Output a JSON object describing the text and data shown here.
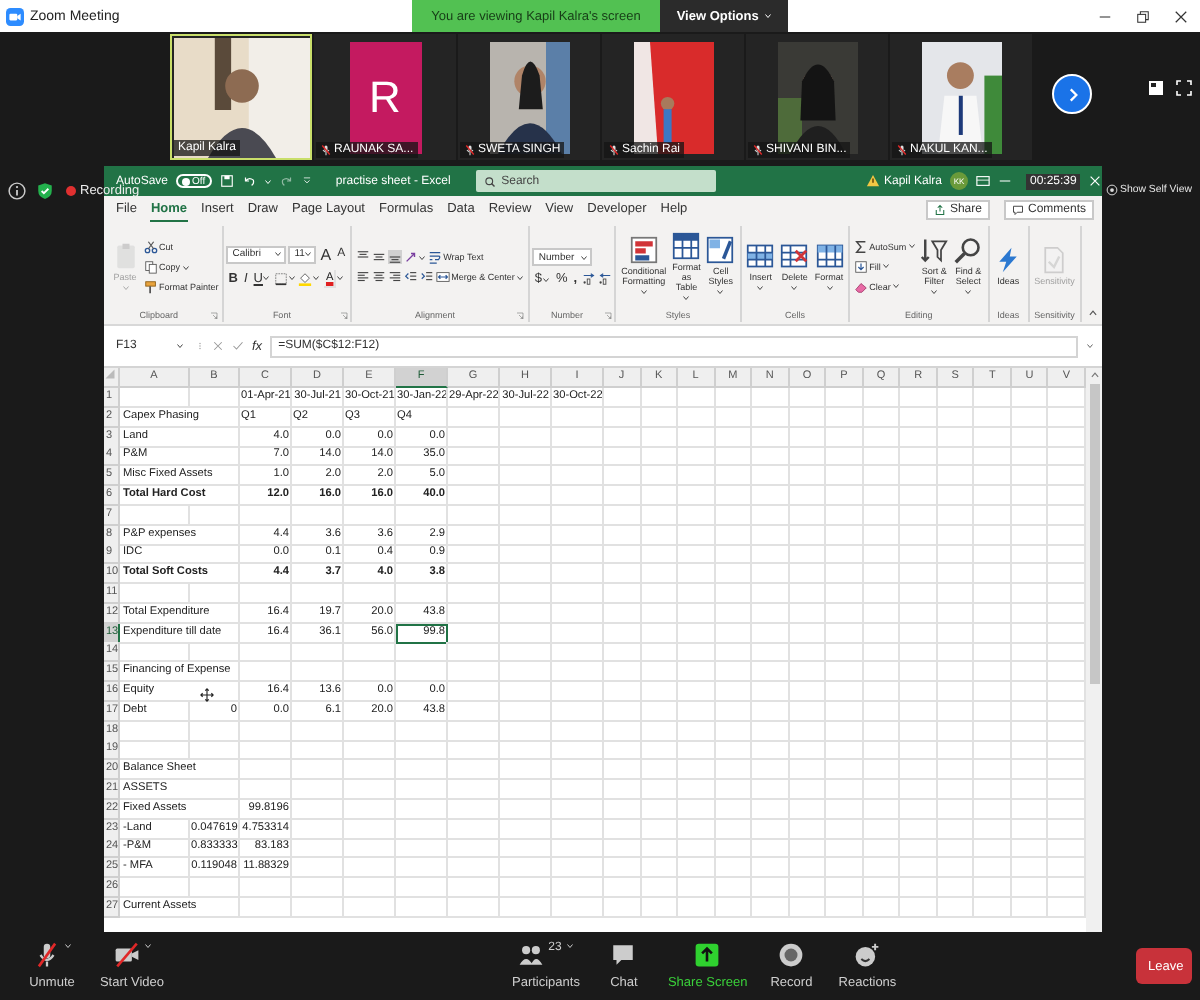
{
  "meeting": {
    "title": "Zoom Meeting",
    "banner": "You are viewing Kapil Kalra's screen",
    "view_options": "View Options",
    "recording": "Recording",
    "timer": "00:25:39",
    "self_view": "Show Self View"
  },
  "participants": [
    {
      "name": "Kapil Kalra",
      "kind": "video",
      "muted": false,
      "speaking": true
    },
    {
      "name": "RAUNAK SA...",
      "kind": "initial",
      "initial": "R",
      "muted": true,
      "speaking": false
    },
    {
      "name": "SWETA SINGH",
      "kind": "portrait",
      "muted": true,
      "speaking": false
    },
    {
      "name": "Sachin Rai",
      "kind": "portrait",
      "muted": true,
      "speaking": false
    },
    {
      "name": "SHIVANI BIN...",
      "kind": "portrait",
      "muted": true,
      "speaking": false
    },
    {
      "name": "NAKUL KAN...",
      "kind": "portrait",
      "muted": true,
      "speaking": false
    }
  ],
  "excel": {
    "autosave_label": "AutoSave",
    "autosave_on": false,
    "autosave_state": "Off",
    "title": "practise sheet - Excel",
    "search_placeholder": "Search",
    "user": "Kapil Kalra",
    "avatar": "KK",
    "tabs": [
      {
        "label": "File",
        "selected": false
      },
      {
        "label": "Home",
        "selected": true
      },
      {
        "label": "Insert",
        "selected": false
      },
      {
        "label": "Draw",
        "selected": false
      },
      {
        "label": "Page Layout",
        "selected": false
      },
      {
        "label": "Formulas",
        "selected": false
      },
      {
        "label": "Data",
        "selected": false
      },
      {
        "label": "Review",
        "selected": false
      },
      {
        "label": "View",
        "selected": false
      },
      {
        "label": "Developer",
        "selected": false
      },
      {
        "label": "Help",
        "selected": false
      }
    ],
    "share": "Share",
    "comments": "Comments",
    "ribbon": [
      {
        "name": "Clipboard",
        "launcher": true,
        "lines": [
          {
            "controls": [
              {
                "kind": "large",
                "label": "Paste",
                "disabled": true,
                "caret": true
              },
              {
                "kind": "stack",
                "items": [
                  {
                    "kind": "small",
                    "label": "Cut"
                  },
                  {
                    "kind": "small",
                    "label": "Copy",
                    "caret": true
                  },
                  {
                    "kind": "small",
                    "label": "Format Painter"
                  }
                ]
              }
            ]
          }
        ]
      },
      {
        "name": "Font",
        "launcher": true,
        "lines": [
          {
            "controls": [
              {
                "kind": "dropdown",
                "value": "Calibri"
              },
              {
                "kind": "dropdown",
                "value": "11"
              },
              {
                "kind": "glyph",
                "label": "A"
              },
              {
                "kind": "glyph",
                "label": "A"
              }
            ]
          },
          {
            "controls": [
              {
                "kind": "glyph",
                "label": "B"
              },
              {
                "kind": "glyph",
                "label": "I"
              },
              {
                "kind": "glyph",
                "label": "U",
                "caret": true
              },
              {
                "kind": "icon",
                "caret": true
              },
              {
                "kind": "icon",
                "caret": true
              },
              {
                "kind": "glyph",
                "label": "A",
                "caret": true
              }
            ]
          }
        ]
      },
      {
        "name": "Alignment",
        "launcher": true,
        "lines": [
          {
            "controls": [
              {
                "kind": "icon",
                "selected": false
              },
              {
                "kind": "icon",
                "selected": false
              },
              {
                "kind": "icon",
                "selected": true
              },
              {
                "kind": "icon",
                "caret": true
              },
              {
                "kind": "small",
                "label": "Wrap Text"
              }
            ]
          },
          {
            "controls": [
              {
                "kind": "icon"
              },
              {
                "kind": "icon"
              },
              {
                "kind": "icon"
              },
              {
                "kind": "icon"
              },
              {
                "kind": "icon"
              },
              {
                "kind": "small",
                "label": "Merge & Center",
                "caret": true
              }
            ]
          }
        ]
      },
      {
        "name": "Number",
        "launcher": true,
        "lines": [
          {
            "controls": [
              {
                "kind": "dropdown",
                "value": "Number"
              }
            ]
          },
          {
            "controls": [
              {
                "kind": "glyph",
                "label": "$",
                "caret": true
              },
              {
                "kind": "glyph",
                "label": "%"
              },
              {
                "kind": "glyph",
                "label": ","
              },
              {
                "kind": "icon"
              },
              {
                "kind": "icon"
              }
            ]
          }
        ]
      },
      {
        "name": "Styles",
        "launcher": false,
        "lines": [
          {
            "controls": [
              {
                "kind": "large",
                "label": "Conditional Formatting",
                "disabled": false,
                "caret": true
              },
              {
                "kind": "large",
                "label": "Format as Table",
                "disabled": false,
                "caret": true
              },
              {
                "kind": "large",
                "label": "Cell Styles",
                "disabled": false,
                "caret": true
              }
            ]
          }
        ]
      },
      {
        "name": "Cells",
        "launcher": false,
        "lines": [
          {
            "controls": [
              {
                "kind": "large",
                "label": "Insert",
                "disabled": false,
                "caret": true
              },
              {
                "kind": "large",
                "label": "Delete",
                "disabled": false,
                "caret": true
              },
              {
                "kind": "large",
                "label": "Format",
                "disabled": false,
                "caret": true
              }
            ]
          }
        ]
      },
      {
        "name": "Editing",
        "launcher": false,
        "lines": [
          {
            "controls": [
              {
                "kind": "stack",
                "items": [
                  {
                    "kind": "small",
                    "label": "AutoSum",
                    "caret": true
                  },
                  {
                    "kind": "small",
                    "label": "Fill",
                    "caret": true
                  },
                  {
                    "kind": "small",
                    "label": "Clear",
                    "caret": true
                  }
                ]
              },
              {
                "kind": "large",
                "label": "Sort & Filter",
                "disabled": false,
                "caret": true
              },
              {
                "kind": "large",
                "label": "Find & Select",
                "disabled": false,
                "caret": true
              }
            ]
          }
        ]
      },
      {
        "name": "Ideas",
        "launcher": false,
        "lines": [
          {
            "controls": [
              {
                "kind": "large",
                "label": "Ideas",
                "disabled": false
              }
            ]
          }
        ]
      },
      {
        "name": "Sensitivity",
        "launcher": false,
        "lines": [
          {
            "controls": [
              {
                "kind": "large",
                "label": "Sensitivity",
                "disabled": true
              }
            ]
          }
        ]
      }
    ],
    "formula_bar": {
      "name_box": "F13",
      "fx": "fx",
      "formula": "=SUM($C$12:F12)"
    },
    "sheet": {
      "columns": [
        {
          "label": "A",
          "selected": false
        },
        {
          "label": "B",
          "selected": false
        },
        {
          "label": "C",
          "selected": false
        },
        {
          "label": "D",
          "selected": false
        },
        {
          "label": "E",
          "selected": false
        },
        {
          "label": "F",
          "selected": true
        },
        {
          "label": "G",
          "selected": false
        },
        {
          "label": "H",
          "selected": false
        },
        {
          "label": "I",
          "selected": false
        },
        {
          "label": "J",
          "selected": false
        },
        {
          "label": "K",
          "selected": false
        },
        {
          "label": "L",
          "selected": false
        },
        {
          "label": "M",
          "selected": false
        },
        {
          "label": "N",
          "selected": false
        },
        {
          "label": "O",
          "selected": false
        },
        {
          "label": "P",
          "selected": false
        },
        {
          "label": "Q",
          "selected": false
        },
        {
          "label": "R",
          "selected": false
        },
        {
          "label": "S",
          "selected": false
        },
        {
          "label": "T",
          "selected": false
        },
        {
          "label": "U",
          "selected": false
        },
        {
          "label": "V",
          "selected": false
        }
      ],
      "rows": [
        {
          "number": "1",
          "bold": false,
          "selected": false,
          "values_left": false,
          "cells": [
            null,
            null,
            "01-Apr-21",
            "30-Jul-21",
            "30-Oct-21",
            "30-Jan-22",
            "29-Apr-22",
            "30-Jul-22",
            "30-Oct-22"
          ]
        },
        {
          "number": "2",
          "bold": false,
          "selected": false,
          "values_left": true,
          "cells": [
            "Capex Phasing",
            null,
            "Q1",
            "Q2",
            "Q3",
            "Q4"
          ]
        },
        {
          "number": "3",
          "bold": false,
          "selected": false,
          "values_left": false,
          "cells": [
            "Land",
            null,
            "4.0",
            "0.0",
            "0.0",
            "0.0"
          ]
        },
        {
          "number": "4",
          "bold": false,
          "selected": false,
          "values_left": false,
          "cells": [
            "P&M",
            null,
            "7.0",
            "14.0",
            "14.0",
            "35.0"
          ]
        },
        {
          "number": "5",
          "bold": false,
          "selected": false,
          "values_left": false,
          "cells": [
            "Misc Fixed Assets",
            null,
            "1.0",
            "2.0",
            "2.0",
            "5.0"
          ]
        },
        {
          "number": "6",
          "bold": true,
          "selected": false,
          "values_left": false,
          "cells": [
            "Total Hard Cost",
            null,
            "12.0",
            "16.0",
            "16.0",
            "40.0"
          ]
        },
        {
          "number": "7",
          "selected": false,
          "cells": []
        },
        {
          "number": "8",
          "bold": false,
          "selected": false,
          "values_left": false,
          "cells": [
            "P&P expenses",
            null,
            "4.4",
            "3.6",
            "3.6",
            "2.9"
          ]
        },
        {
          "number": "9",
          "bold": false,
          "selected": false,
          "values_left": false,
          "cells": [
            "IDC",
            null,
            "0.0",
            "0.1",
            "0.4",
            "0.9"
          ]
        },
        {
          "number": "10",
          "bold": true,
          "selected": false,
          "values_left": false,
          "cells": [
            "Total Soft Costs",
            null,
            "4.4",
            "3.7",
            "4.0",
            "3.8"
          ]
        },
        {
          "number": "11",
          "selected": false,
          "cells": []
        },
        {
          "number": "12",
          "bold": false,
          "selected": false,
          "values_left": false,
          "cells": [
            "Total Expenditure",
            null,
            "16.4",
            "19.7",
            "20.0",
            "43.8"
          ]
        },
        {
          "number": "13",
          "bold": false,
          "selected": true,
          "values_left": false,
          "cells": [
            "Expenditure till date",
            null,
            "16.4",
            "36.1",
            "56.0",
            "99.8"
          ]
        },
        {
          "number": "14",
          "selected": false,
          "cells": []
        },
        {
          "number": "15",
          "bold": false,
          "selected": false,
          "cells": [
            "Financing of Expense"
          ]
        },
        {
          "number": "16",
          "bold": false,
          "selected": false,
          "values_left": false,
          "cells": [
            "Equity",
            null,
            "16.4",
            "13.6",
            "0.0",
            "0.0"
          ]
        },
        {
          "number": "17",
          "bold": false,
          "selected": false,
          "values_left": false,
          "cells": [
            "Debt",
            "0",
            "0.0",
            "6.1",
            "20.0",
            "43.8"
          ]
        },
        {
          "number": "18",
          "selected": false,
          "cells": []
        },
        {
          "number": "19",
          "selected": false,
          "cells": []
        },
        {
          "number": "20",
          "bold": false,
          "selected": false,
          "cells": [
            "Balance Sheet"
          ]
        },
        {
          "number": "21",
          "bold": false,
          "selected": false,
          "cells": [
            "ASSETS"
          ]
        },
        {
          "number": "22",
          "bold": false,
          "selected": false,
          "values_left": false,
          "cells": [
            "Fixed Assets",
            null,
            "99.8196"
          ]
        },
        {
          "number": "23",
          "bold": false,
          "selected": false,
          "values_left": false,
          "cells": [
            "-Land",
            "0.047619",
            "4.753314"
          ]
        },
        {
          "number": "24",
          "bold": false,
          "selected": false,
          "values_left": false,
          "cells": [
            "-P&M",
            "0.833333",
            "83.183"
          ]
        },
        {
          "number": "25",
          "bold": false,
          "selected": false,
          "values_left": false,
          "cells": [
            "- MFA",
            "0.119048",
            "11.88329"
          ]
        },
        {
          "number": "26",
          "selected": false,
          "cells": []
        },
        {
          "number": "27",
          "bold": false,
          "selected": false,
          "cells": [
            "Current Assets"
          ]
        }
      ]
    }
  },
  "toolbar": {
    "left": [
      {
        "label": "Unmute",
        "off": true,
        "caret": true
      },
      {
        "label": "Start Video",
        "off": true,
        "caret": true
      }
    ],
    "center": [
      {
        "label": "Participants",
        "count": "23",
        "caret": true,
        "highlight": false
      },
      {
        "label": "Chat",
        "highlight": false
      },
      {
        "label": "Share Screen",
        "highlight": true
      },
      {
        "label": "Record",
        "highlight": false
      },
      {
        "label": "Reactions",
        "highlight": false
      }
    ],
    "leave": "Leave"
  }
}
